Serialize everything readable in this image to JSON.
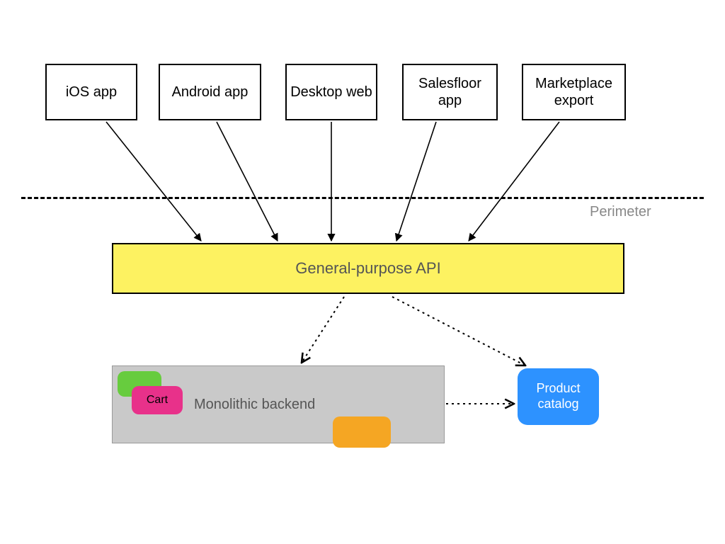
{
  "clients": {
    "ios": {
      "label": "iOS app"
    },
    "android": {
      "label": "Android app"
    },
    "desktop": {
      "label": "Desktop web"
    },
    "salesfloor": {
      "label": "Salesfloor app"
    },
    "marketplace": {
      "label": "Marketplace export"
    }
  },
  "perimeter": {
    "label": "Perimeter"
  },
  "api": {
    "label": "General-purpose API"
  },
  "backend": {
    "monolith": {
      "label": "Monolithic backend"
    },
    "tags": {
      "green": {
        "label": ""
      },
      "cart": {
        "label": "Cart"
      },
      "orange": {
        "label": ""
      }
    },
    "product_catalog": {
      "label": "Product catalog"
    }
  },
  "colors": {
    "api_bg": "#fdf261",
    "mono_bg": "#c9c9c9",
    "tag_green": "#67cc3e",
    "tag_pink": "#e8318a",
    "tag_orange": "#f5a623",
    "product_blue": "#2d92ff"
  }
}
